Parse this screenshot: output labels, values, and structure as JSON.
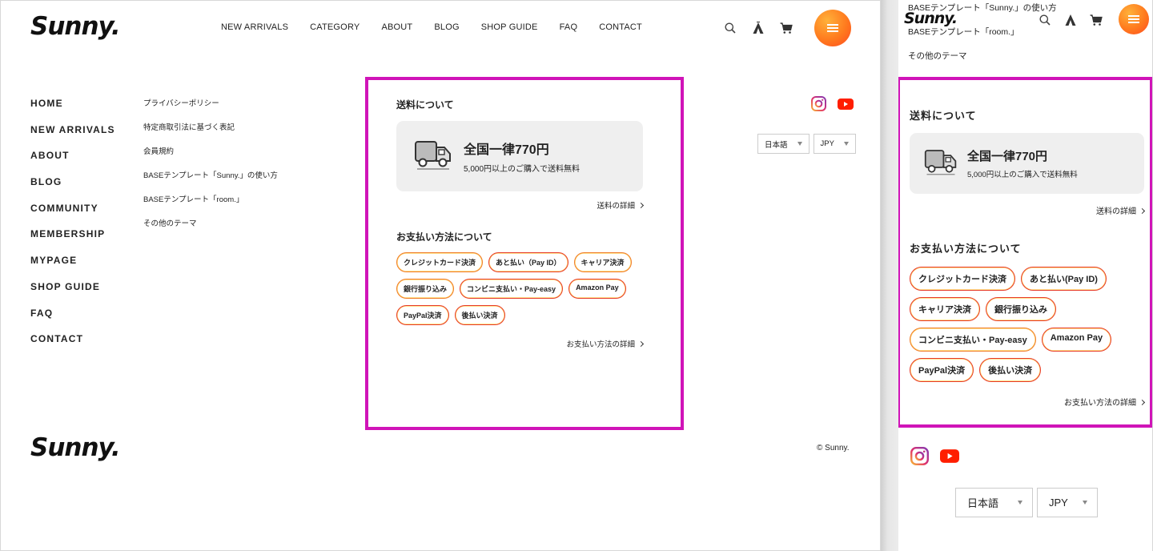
{
  "brand": {
    "logo": "Sunny."
  },
  "nav": [
    "NEW ARRIVALS",
    "CATEGORY",
    "ABOUT",
    "BLOG",
    "SHOP GUIDE",
    "FAQ",
    "CONTACT"
  ],
  "header_icons": [
    "search-icon",
    "tent-icon",
    "cart-icon",
    "menu-icon"
  ],
  "menu": {
    "main": [
      "HOME",
      "NEW ARRIVALS",
      "ABOUT",
      "BLOG",
      "COMMUNITY",
      "MEMBERSHIP",
      "MYPAGE",
      "SHOP GUIDE",
      "FAQ",
      "CONTACT"
    ],
    "sub": [
      "プライバシーポリシー",
      "特定商取引法に基づく表記",
      "会員規約",
      "BASEテンプレート「Sunny.」の使い方",
      "BASEテンプレート「room.」",
      "その他のテーマ"
    ]
  },
  "shipping": {
    "title": "送料について",
    "headline": "全国一律770円",
    "note": "5,000円以上のご購入で送料無料",
    "detail_link": "送料の詳細"
  },
  "payment": {
    "title": "お支払い方法について",
    "methods_desktop": [
      "クレジットカード決済",
      "あと払い（Pay ID）",
      "キャリア決済",
      "銀行振り込み",
      "コンビニ支払い・Pay-easy",
      "Amazon Pay",
      "PayPal決済",
      "後払い決済"
    ],
    "methods_mobile": [
      "クレジットカード決済",
      "あと払い(Pay ID)",
      "キャリア決済",
      "銀行振り込み",
      "コンビニ支払い・Pay-easy",
      "Amazon Pay",
      "PayPal決済",
      "後払い決済"
    ],
    "detail_link": "お支払い方法の詳細"
  },
  "selectors": {
    "language": "日本語",
    "currency": "JPY"
  },
  "social": [
    "instagram-icon",
    "youtube-icon"
  ],
  "copyright": "© Sunny.",
  "mobile_links": [
    "BASEテンプレート「Sunny.」の使い方",
    "BASEテンプレート「room.」",
    "その他のテーマ"
  ],
  "colors": {
    "highlight": "#d014b8",
    "accent": "#ff7a1e",
    "pill_border": "#f07b2a"
  }
}
